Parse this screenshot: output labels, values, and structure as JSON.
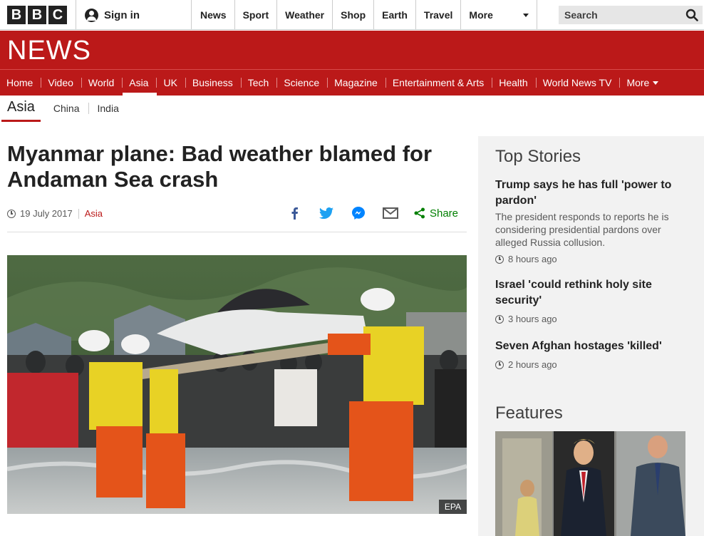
{
  "brand": {
    "letters": [
      "B",
      "B",
      "C"
    ],
    "news_logo": "NEWS"
  },
  "account": {
    "signin_label": "Sign in"
  },
  "top_nav": {
    "items": [
      "News",
      "Sport",
      "Weather",
      "Shop",
      "Earth",
      "Travel"
    ],
    "more_label": "More"
  },
  "search": {
    "placeholder": "Search"
  },
  "news_nav": {
    "items": [
      "Home",
      "Video",
      "World",
      "Asia",
      "UK",
      "Business",
      "Tech",
      "Science",
      "Magazine",
      "Entertainment & Arts",
      "Health",
      "World News TV"
    ],
    "more_label": "More",
    "active": "Asia"
  },
  "section_nav": {
    "title": "Asia",
    "links": [
      "China",
      "India"
    ]
  },
  "article": {
    "headline": "Myanmar plane: Bad weather blamed for Andaman Sea crash",
    "date": "19 July 2017",
    "section": "Asia",
    "share_label": "Share",
    "share_icons": [
      "facebook-icon",
      "twitter-icon",
      "messenger-icon",
      "email-icon"
    ],
    "image_credit": "EPA"
  },
  "sidebar": {
    "top_stories_heading": "Top Stories",
    "stories": [
      {
        "title": "Trump says he has full 'power to pardon'",
        "summary": "The president responds to reports he is considering presidential pardons over alleged Russia collusion.",
        "time": "8 hours ago"
      },
      {
        "title": "Israel 'could rethink holy site security'",
        "time": "3 hours ago"
      },
      {
        "title": "Seven Afghan hostages 'killed'",
        "time": "2 hours ago"
      }
    ],
    "features_heading": "Features"
  },
  "colors": {
    "brand_red": "#bb1919",
    "share_green": "#007f00",
    "facebook": "#3b5998",
    "twitter": "#1da1f2",
    "messenger": "#0084ff"
  }
}
